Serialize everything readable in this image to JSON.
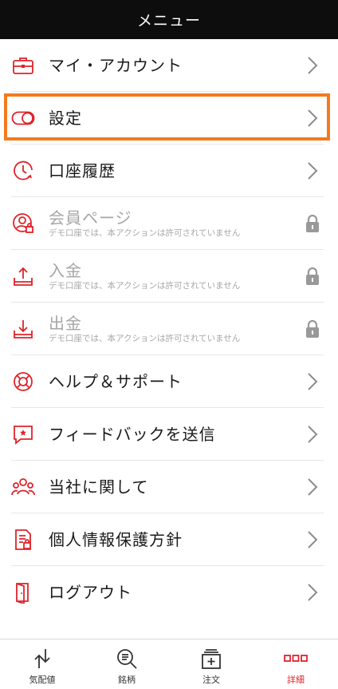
{
  "header": {
    "title": "メニュー"
  },
  "menu": {
    "items": [
      {
        "label": "マイ・アカウント",
        "icon": "briefcase-icon"
      },
      {
        "label": "設定",
        "icon": "toggle-icon"
      },
      {
        "label": "口座履歴",
        "icon": "history-clock-icon"
      },
      {
        "label": "会員ページ",
        "sub": "デモ口座では、本アクションは許可されていません",
        "icon": "member-lock-icon"
      },
      {
        "label": "入金",
        "sub": "デモ口座では、本アクションは許可されていません",
        "icon": "upload-tray-icon"
      },
      {
        "label": "出金",
        "sub": "デモ口座では、本アクションは許可されていません",
        "icon": "download-tray-icon"
      },
      {
        "label": "ヘルプ＆サポート",
        "icon": "lifebuoy-icon"
      },
      {
        "label": "フィードバックを送信",
        "icon": "feedback-bubble-icon"
      },
      {
        "label": "当社に関して",
        "icon": "people-group-icon"
      },
      {
        "label": "個人情報保護方針",
        "icon": "document-lock-icon"
      },
      {
        "label": "ログアウト",
        "icon": "door-exit-icon"
      }
    ]
  },
  "tabbar": {
    "tabs": [
      {
        "label": "気配値",
        "icon": "quotes-arrows-icon"
      },
      {
        "label": "銘柄",
        "icon": "search-list-icon"
      },
      {
        "label": "注文",
        "icon": "order-add-icon"
      },
      {
        "label": "詳細",
        "icon": "more-detail-icon",
        "active": true
      }
    ]
  },
  "colors": {
    "accent": "#e0232a",
    "highlight": "#f47a1d",
    "header_bg": "#0d0d0d",
    "disabled": "#a6a6a6"
  }
}
